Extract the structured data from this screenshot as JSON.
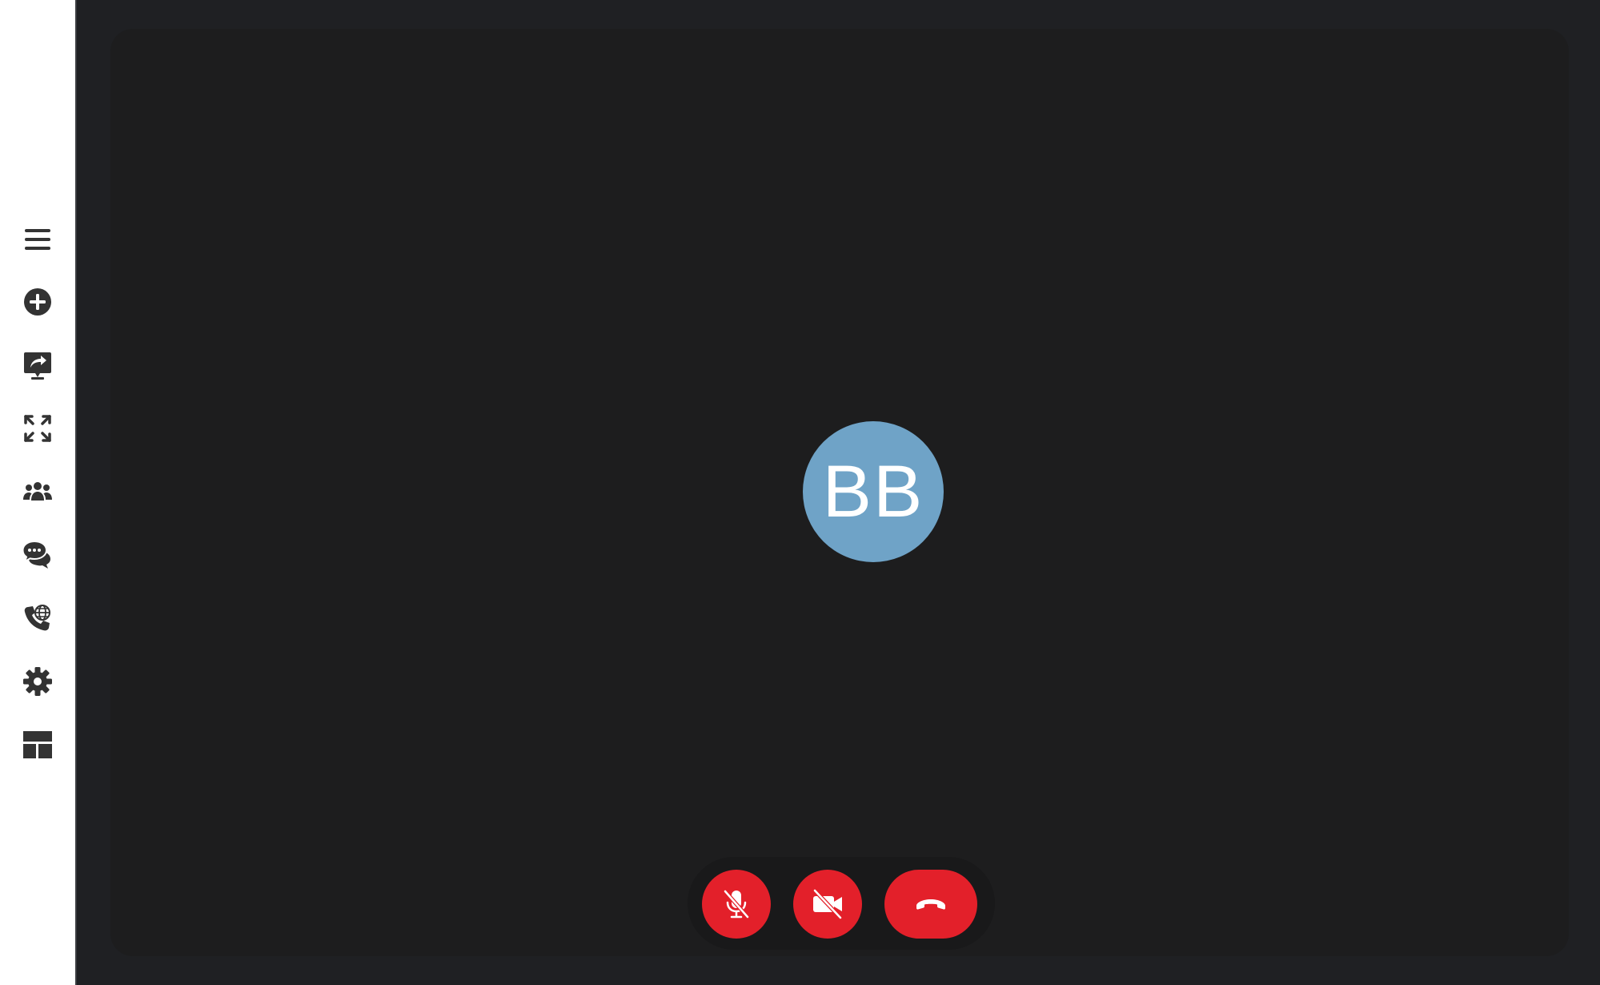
{
  "participant": {
    "initials": "BB",
    "avatar_color": "#6fa3c7"
  },
  "sidebar": {
    "items": [
      {
        "id": "menu",
        "icon": "hamburger-menu-icon"
      },
      {
        "id": "add",
        "icon": "plus-circle-icon"
      },
      {
        "id": "share-screen",
        "icon": "share-screen-icon"
      },
      {
        "id": "fullscreen",
        "icon": "expand-arrows-icon"
      },
      {
        "id": "participants",
        "icon": "users-icon"
      },
      {
        "id": "chat",
        "icon": "chat-bubbles-icon"
      },
      {
        "id": "dial-in",
        "icon": "phone-globe-icon"
      },
      {
        "id": "settings",
        "icon": "gear-icon"
      },
      {
        "id": "layout",
        "icon": "layout-grid-icon"
      }
    ]
  },
  "controls": {
    "mic": {
      "state": "muted",
      "icon": "microphone-slash-icon"
    },
    "camera": {
      "state": "off",
      "icon": "video-slash-icon"
    },
    "hangup": {
      "icon": "phone-hangup-icon"
    },
    "accent_color": "#e3202a"
  },
  "colors": {
    "background": "#1f2023",
    "video_area": "#1d1d1e",
    "sidebar": "#ffffff",
    "icon": "#333333"
  }
}
